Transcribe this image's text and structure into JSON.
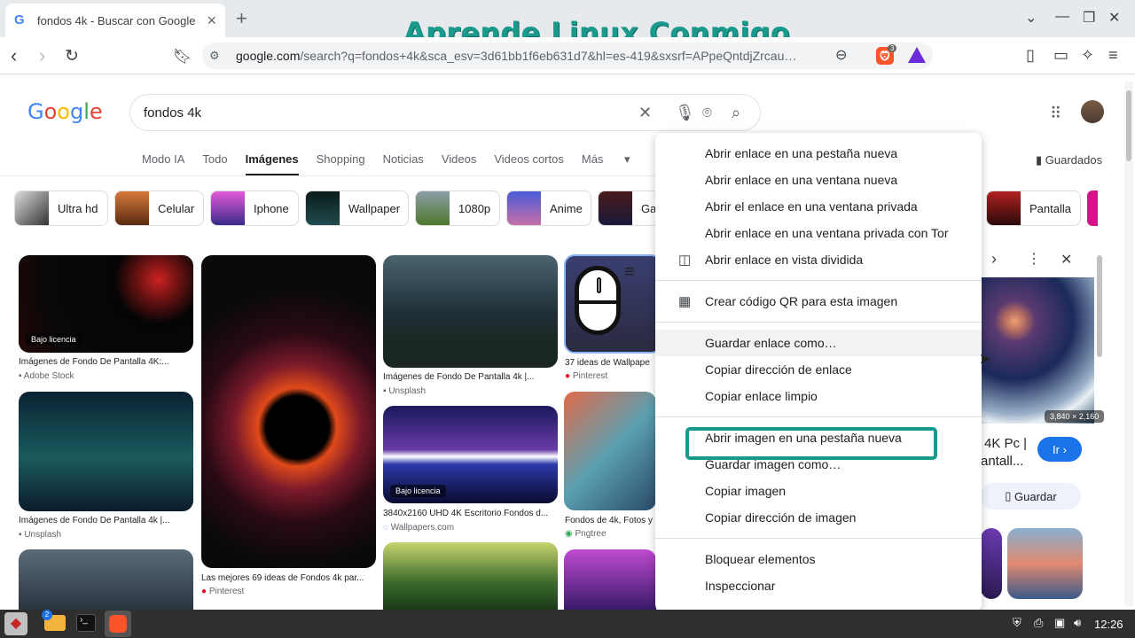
{
  "browser": {
    "tab_title": "fondos 4k - Buscar con Google",
    "url_host": "google.com",
    "url_rest": "/search?q=fondos+4k&sca_esv=3d61bb1f6eb631d7&hl=es-419&sxsrf=APpeQntdjZrcau…",
    "brave_badge": "3"
  },
  "watermark": "Aprende Linux Conmigo",
  "google": {
    "logo": "Google",
    "query": "fondos 4k",
    "saved": "Guardados",
    "tabs": [
      "Modo IA",
      "Todo",
      "Imágenes",
      "Shopping",
      "Noticias",
      "Videos",
      "Videos cortos",
      "Más"
    ]
  },
  "chips": [
    "Ultra hd",
    "Celular",
    "Iphone",
    "Wallpaper",
    "1080p",
    "Anime",
    "Ga",
    "Pantalla"
  ],
  "results": [
    {
      "badge": "Bajo licencia",
      "cap": "Imágenes de Fondo De Pantalla 4K:...",
      "src": "Adobe Stock"
    },
    {
      "cap": "Imágenes de Fondo De Pantalla 4k |...",
      "src": "Unsplash"
    },
    {
      "cap": "Las mejores 69 ideas de Fondos 4k par...",
      "src": "Pinterest"
    },
    {
      "cap": "Imágenes de Fondo De Pantalla 4k |...",
      "src": "Unsplash"
    },
    {
      "badge": "Bajo licencia",
      "cap": "3840x2160 UHD 4K Escritorio Fondos d...",
      "src": "Wallpapers.com"
    },
    {
      "cap": "37 ideas de Wallpape",
      "src": "Pinterest"
    },
    {
      "cap": "Fondos de 4k, Fotos y",
      "src": "Pngtree"
    }
  ],
  "side": {
    "dims": "3,840 × 2,160",
    "title1": "4K Pc |",
    "title2": "antall...",
    "go": "Ir",
    "save": "Guardar"
  },
  "menu": {
    "g1": [
      "Abrir enlace en una pestaña nueva",
      "Abrir enlace en una ventana nueva",
      "Abrir el enlace en una ventana privada",
      "Abrir enlace en una ventana privada con Tor",
      "Abrir enlace en vista dividida"
    ],
    "qr": "Crear código QR para esta imagen",
    "g3": [
      "Guardar enlace como…",
      "Copiar dirección de enlace",
      "Copiar enlace limpio"
    ],
    "g4": [
      "Abrir imagen en una pestaña nueva",
      "Guardar imagen como…",
      "Copiar imagen",
      "Copiar dirección de imagen"
    ],
    "g5": [
      "Bloquear elementos",
      "Inspeccionar"
    ]
  },
  "taskbar": {
    "clock": "12:26",
    "badge": "2"
  }
}
